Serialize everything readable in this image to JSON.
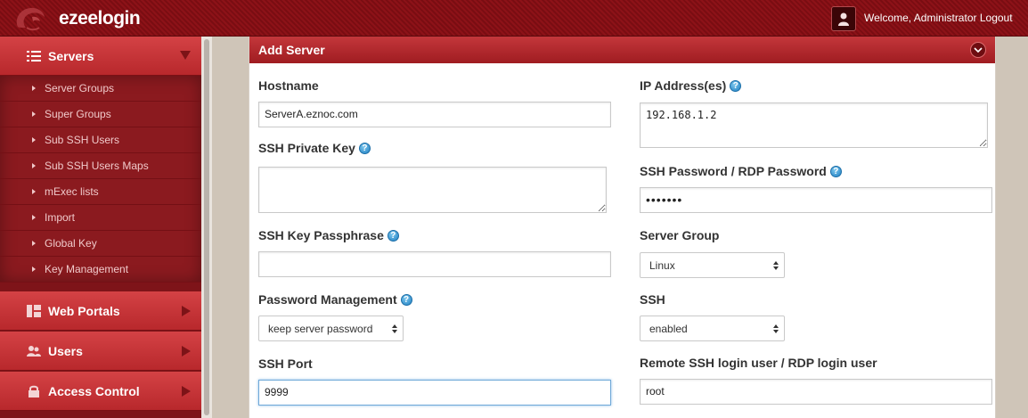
{
  "header": {
    "brand": "ezeelogin",
    "welcome_text": "Welcome, Administrator",
    "logout_label": "Logout"
  },
  "sidebar": {
    "servers": {
      "label": "Servers",
      "items": [
        {
          "label": "Server Groups"
        },
        {
          "label": "Super Groups"
        },
        {
          "label": "Sub SSH Users"
        },
        {
          "label": "Sub SSH Users Maps"
        },
        {
          "label": "mExec lists"
        },
        {
          "label": "Import"
        },
        {
          "label": "Global Key"
        },
        {
          "label": "Key Management"
        }
      ]
    },
    "web_portals": {
      "label": "Web Portals"
    },
    "users": {
      "label": "Users"
    },
    "access_control": {
      "label": "Access Control"
    }
  },
  "panel": {
    "title": "Add Server",
    "hostname": {
      "label": "Hostname",
      "value": "ServerA.eznoc.com"
    },
    "ip": {
      "label": "IP Address(es)",
      "value": "192.168.1.2"
    },
    "ssh_private_key": {
      "label": "SSH Private Key",
      "value": ""
    },
    "ssh_password": {
      "label": "SSH Password / RDP Password",
      "value": "•••••••"
    },
    "ssh_key_passphrase": {
      "label": "SSH Key Passphrase",
      "value": ""
    },
    "server_group": {
      "label": "Server Group",
      "value": "Linux"
    },
    "password_management": {
      "label": "Password Management",
      "value": "keep server password"
    },
    "ssh": {
      "label": "SSH",
      "value": "enabled"
    },
    "ssh_port": {
      "label": "SSH Port",
      "value": "9999"
    },
    "remote_user": {
      "label": "Remote SSH login user / RDP login user",
      "value": "root"
    }
  },
  "icons": {
    "help": "?",
    "colors": {
      "header": "#8d1218",
      "sidebar": "#7e1419",
      "accent": "#c4373b",
      "help": "#1f7fc2"
    }
  }
}
